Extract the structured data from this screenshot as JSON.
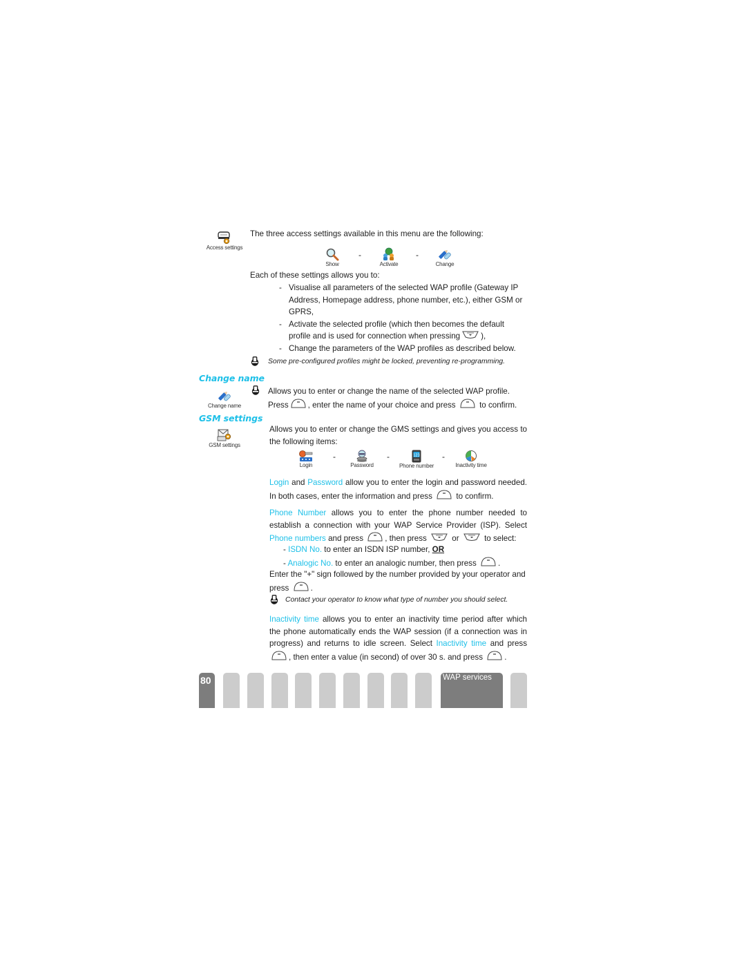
{
  "sidebar_icons": {
    "access_settings": "Access settings",
    "change_name": "Change name",
    "gsm_settings": "GSM settings"
  },
  "intro": {
    "text": "The three access settings available in this menu are the following:",
    "options": [
      {
        "label": "Show",
        "icon": "magnifier-icon"
      },
      {
        "label": "Activate",
        "icon": "globe-people-icon"
      },
      {
        "label": "Change",
        "icon": "pencil-icon"
      }
    ],
    "separator": "-",
    "allows_text": "Each of these settings allows you to:",
    "bullets": [
      "Visualise all parameters of the selected WAP profile (Gateway IP Address, Homepage address, phone number, etc.), either GSM or GPRS,",
      "Activate the selected profile (which then becomes the default profile and is used for connection when pressing",
      "Change the parameters of the WAP profiles as described below."
    ],
    "bullet2_suffix": "),",
    "note": "Some pre-configured profiles might be locked, preventing re-programming."
  },
  "change_name": {
    "heading": "Change name",
    "line1": "Allows you to enter or change the name of the selected WAP profile.",
    "line2_a": "Press",
    "line2_b": ", enter the name of your choice and press",
    "line2_c": "to confirm."
  },
  "gsm_settings": {
    "heading": "GSM settings",
    "intro": "Allows you to enter or change the GMS settings and gives you access to the following items:",
    "items": [
      {
        "label": "Login",
        "icon": "login-key-icon"
      },
      {
        "label": "Password",
        "icon": "password-safe-icon"
      },
      {
        "label": "Phone number",
        "icon": "phone-icon"
      },
      {
        "label": "Inactivity time",
        "icon": "clock-icon"
      }
    ],
    "separator": "-",
    "login_para": {
      "hl1": "Login",
      "t1": " and ",
      "hl2": "Password",
      "t2": " allow you to enter the login and password needed. In both cases, enter the information and press",
      "t3": "to confirm."
    },
    "phone_para": {
      "hl1": "Phone Number",
      "t1": " allows you to enter the phone number needed to establish a connection with your WAP Service Provider (ISP). Select ",
      "hl2": "Phone numbers",
      "t2": " and press",
      "t3": ", then press",
      "t4": "or",
      "t5": "to select:",
      "opt1_hl": "ISDN No.",
      "opt1_text": " to enter an ISDN ISP number, ",
      "opt1_or": "OR",
      "opt2_hl": "Analogic No.",
      "opt2_text": " to enter an analogic number, then press",
      "plus_text": "Enter the \"+\" sign followed by the number provided by your operator and press",
      "note": "Contact your operator to know what type of number you should select."
    },
    "inactivity_para": {
      "hl1": "Inactivity time",
      "t1": " allows you to enter an inactivity time period after which the phone automatically ends the WAP session (if a connection was in progress) and returns to idle screen. Select ",
      "hl2": "Inactivity time",
      "t2": " and press",
      "t3": "then enter a value (in second) of over 30 s. and press"
    }
  },
  "footer": {
    "page_number": "80",
    "section_tab": "WAP services"
  },
  "colors": {
    "highlight": "#1ec0e8",
    "tab_active": "#7d7d7d",
    "tab_inactive": "#cccccc"
  }
}
